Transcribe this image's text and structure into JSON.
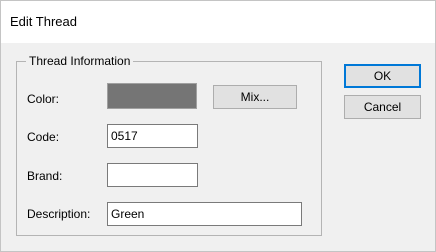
{
  "dialog": {
    "title": "Edit Thread"
  },
  "group": {
    "label": "Thread Information",
    "color_label": "Color:",
    "color_value": "#757575",
    "mix_button": "Mix...",
    "code_label": "Code:",
    "code_value": "0517",
    "brand_label": "Brand:",
    "brand_value": "",
    "description_label": "Description:",
    "description_value": "Green"
  },
  "buttons": {
    "ok": "OK",
    "cancel": "Cancel"
  }
}
